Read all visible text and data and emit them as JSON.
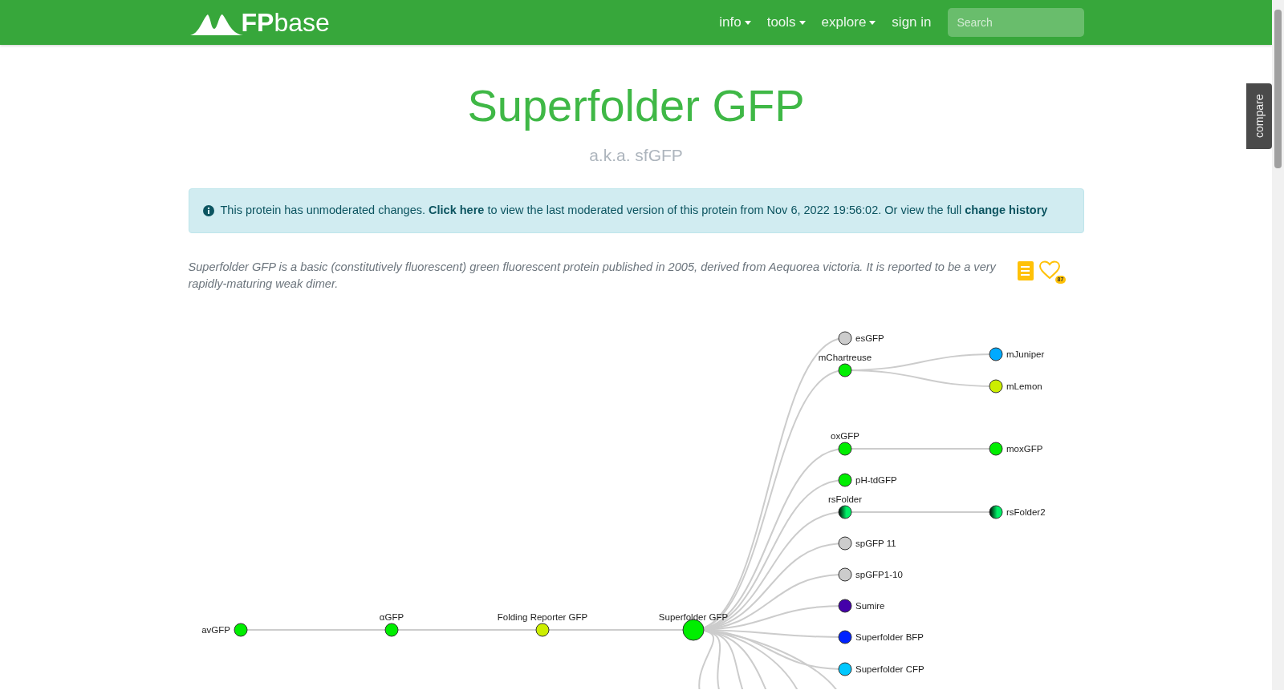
{
  "navbar": {
    "logo": {
      "bold": "FP",
      "light": "base"
    },
    "menus": [
      {
        "label": "info",
        "dropdown": true
      },
      {
        "label": "tools",
        "dropdown": true
      },
      {
        "label": "explore",
        "dropdown": true
      },
      {
        "label": "sign in",
        "dropdown": false
      }
    ],
    "search": {
      "placeholder": "Search"
    }
  },
  "compare_tab": {
    "label": "compare"
  },
  "title": "Superfolder GFP",
  "subtitle": "a.k.a. sfGFP",
  "alert": {
    "text": "This protein has unmoderated changes. **Click here** to view the last moderated version of this protein from Nov 6, 2022 19:56:02. Or view the full **change history**"
  },
  "description": "Superfolder GFP is a basic (constitutively fluorescent) green fluorescent protein published in 2005, derived from Aequorea victoria. It is reported to be a very rapidly-maturing weak dimer.",
  "favorite_count": "87",
  "lineage_tree": {
    "name": "avGFP",
    "color": "#00ee00",
    "selected": false,
    "switchable": false,
    "children": [
      {
        "name": "αGFP",
        "color": "#00ee00",
        "selected": false,
        "switchable": false,
        "children": [
          {
            "name": "Folding Reporter GFP",
            "color": "#ccee00",
            "selected": false,
            "switchable": false,
            "children": [
              {
                "name": "Superfolder GFP",
                "color": "#00ee00",
                "selected": true,
                "switchable": false,
                "children": [
                  {
                    "name": "esGFP",
                    "color": "#cccccc",
                    "selected": false,
                    "switchable": false
                  },
                  {
                    "name": "mChartreuse",
                    "color": "#00ee00",
                    "selected": false,
                    "switchable": false,
                    "children": [
                      {
                        "name": "mJuniper",
                        "color": "#00aaff",
                        "selected": false,
                        "switchable": false
                      },
                      {
                        "name": "mLemon",
                        "color": "#ccee00",
                        "selected": false,
                        "switchable": false
                      }
                    ]
                  },
                  {
                    "name": "oxGFP",
                    "color": "#00ee00",
                    "selected": false,
                    "switchable": false,
                    "children": [
                      {
                        "name": "moxGFP",
                        "color": "#00ee00",
                        "selected": false,
                        "switchable": false
                      }
                    ]
                  },
                  {
                    "name": "pH-tdGFP",
                    "color": "#00ee00",
                    "selected": false,
                    "switchable": false
                  },
                  {
                    "name": "rsFolder",
                    "color": "#00ee66",
                    "selected": false,
                    "switchable": true,
                    "children": [
                      {
                        "name": "rsFolder2",
                        "color": "#00ee66",
                        "selected": false,
                        "switchable": true
                      }
                    ]
                  },
                  {
                    "name": "spGFP 11",
                    "color": "#cccccc",
                    "selected": false,
                    "switchable": false
                  },
                  {
                    "name": "spGFP1-10",
                    "color": "#cccccc",
                    "selected": false,
                    "switchable": false
                  },
                  {
                    "name": "Sumire",
                    "color": "#4400aa",
                    "selected": false,
                    "switchable": false
                  },
                  {
                    "name": "Superfolder BFP",
                    "color": "#0022ff",
                    "selected": false,
                    "switchable": false
                  },
                  {
                    "name": "Superfolder CFP",
                    "color": "#00c8ff",
                    "selected": false,
                    "switchable": false
                  }
                ]
              }
            ]
          }
        ]
      }
    ]
  }
}
